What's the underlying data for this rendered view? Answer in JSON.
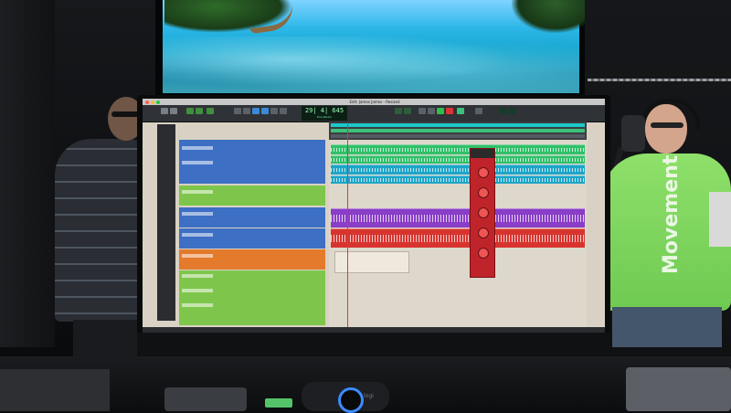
{
  "scene": {
    "description_tag": "recording-studio-daw-monitor"
  },
  "daw": {
    "window_title": "Edit: James James - Resized",
    "counter": "29| 4| 645",
    "counter_mode": "Bars|Beats",
    "colors": {
      "green": "#7ec64b",
      "blue": "#3d6fc4",
      "orange": "#e47a2b",
      "purple": "#8a3dc7",
      "red": "#d8342f",
      "clip_green": "#31c06a",
      "clip_cyan": "#1ea5c8",
      "ruler_cyan": "#1cc9c9",
      "plugin_red": "#c0242b"
    }
  },
  "person_right": {
    "shirt_text": "Movement"
  },
  "webcam": {
    "brand": "logi"
  }
}
